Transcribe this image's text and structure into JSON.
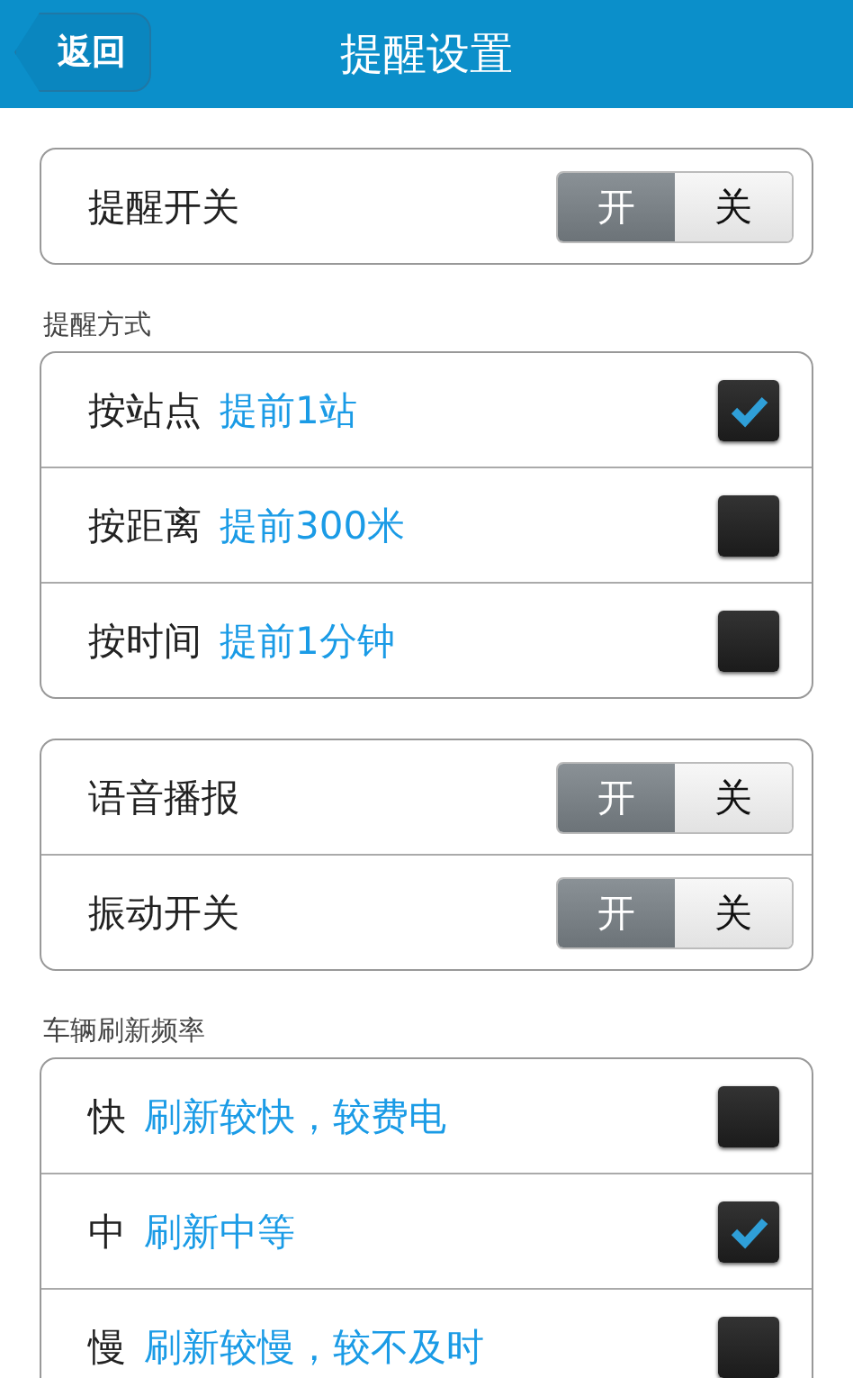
{
  "header": {
    "back_label": "返回",
    "title": "提醒设置"
  },
  "sections": [
    {
      "rows": [
        {
          "kind": "toggle",
          "label": "提醒开关",
          "on_label": "开",
          "off_label": "关",
          "on": true
        }
      ]
    },
    {
      "caption": "提醒方式",
      "rows": [
        {
          "kind": "checkbox",
          "label": "按站点",
          "detail": "提前1站",
          "checked": true
        },
        {
          "kind": "checkbox",
          "label": "按距离",
          "detail": "提前300米",
          "checked": false
        },
        {
          "kind": "checkbox",
          "label": "按时间",
          "detail": "提前1分钟",
          "checked": false
        }
      ]
    },
    {
      "rows": [
        {
          "kind": "toggle",
          "label": "语音播报",
          "on_label": "开",
          "off_label": "关",
          "on": true
        },
        {
          "kind": "toggle",
          "label": "振动开关",
          "on_label": "开",
          "off_label": "关",
          "on": true
        }
      ]
    },
    {
      "caption": "车辆刷新频率",
      "rows": [
        {
          "kind": "checkbox",
          "label": "快",
          "detail": "刷新较快，较费电",
          "checked": false
        },
        {
          "kind": "checkbox",
          "label": "中",
          "detail": "刷新中等",
          "checked": true
        },
        {
          "kind": "checkbox",
          "label": "慢",
          "detail": "刷新较慢，较不及时",
          "checked": false
        }
      ]
    }
  ]
}
